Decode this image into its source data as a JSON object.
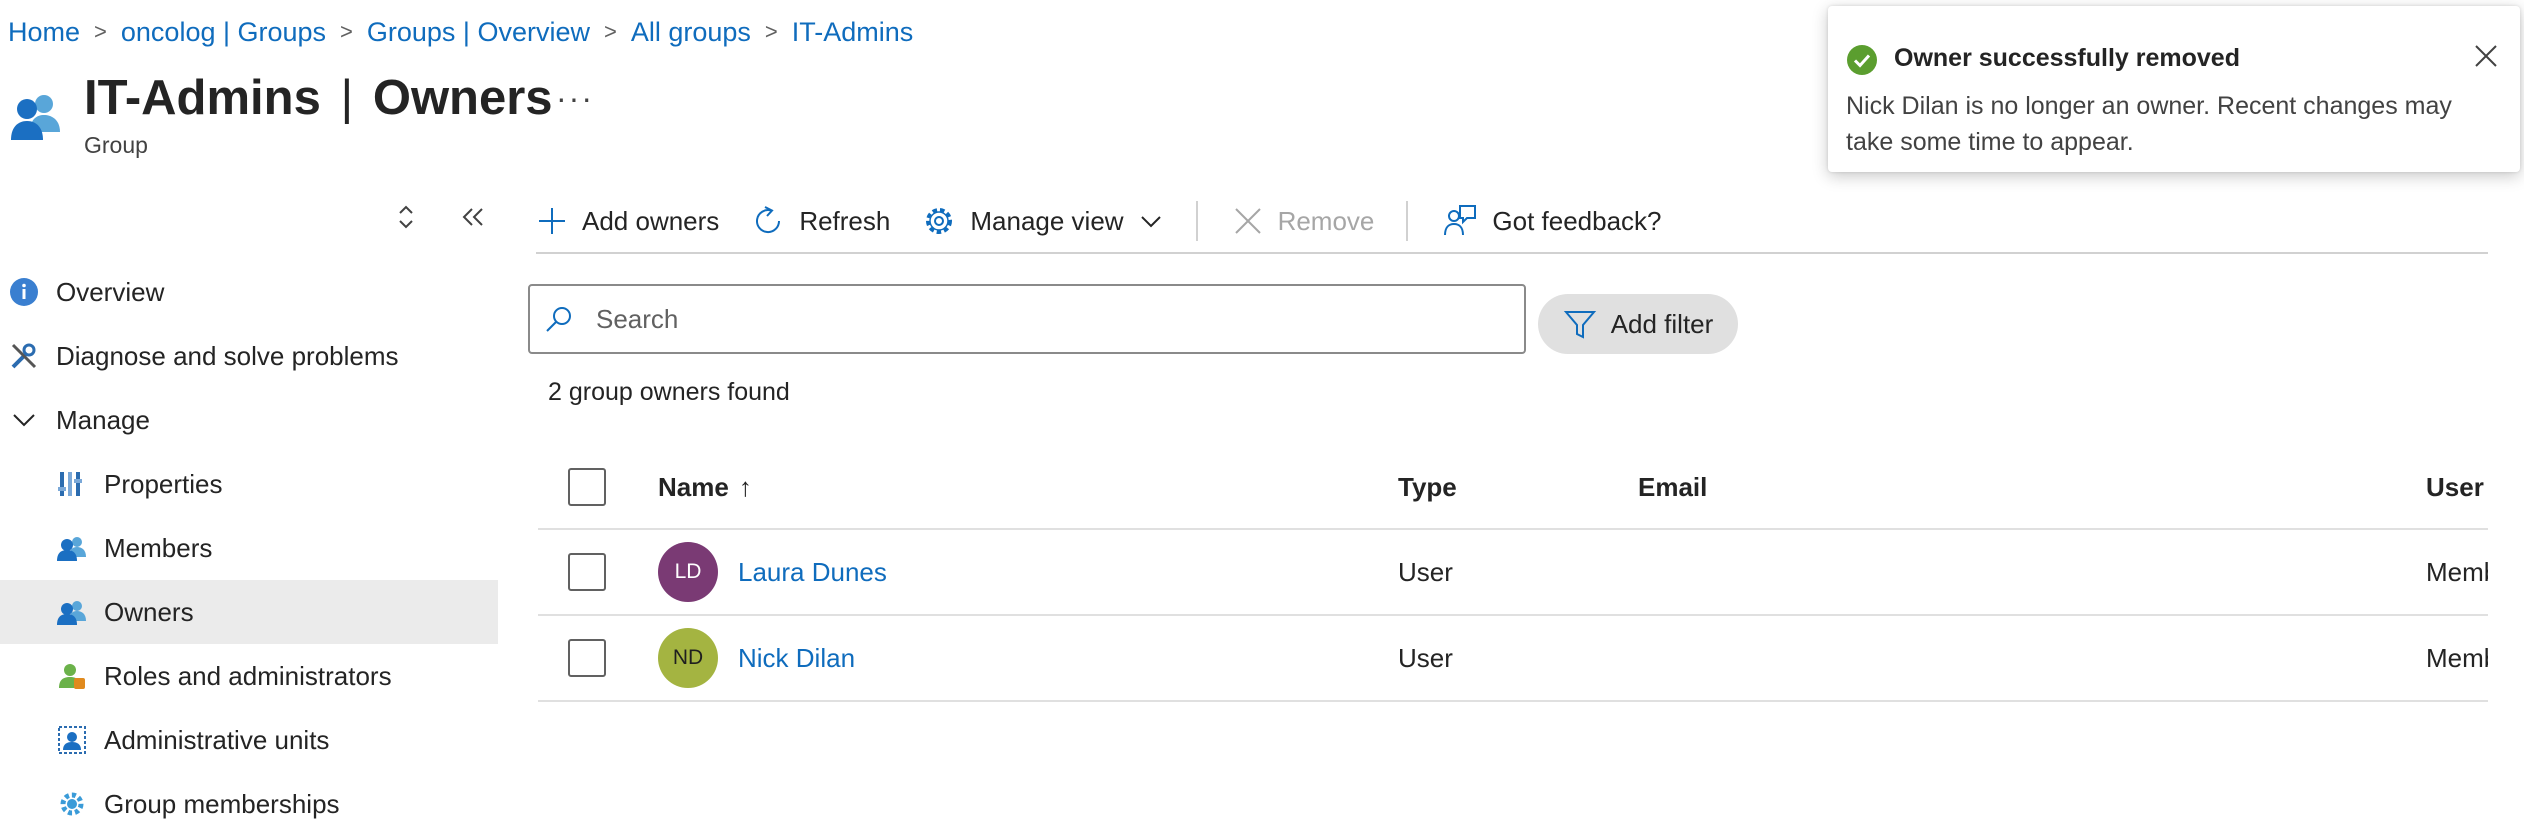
{
  "breadcrumb": [
    "Home",
    "oncolog | Groups",
    "Groups | Overview",
    "All groups",
    "IT-Admins"
  ],
  "header": {
    "title_strong": "IT-Admins",
    "title_divider": "|",
    "title_rest": "Owners",
    "subtitle": "Group",
    "more_label": "···",
    "icon": "group-icon"
  },
  "sidebar": {
    "sort_icon": "up-down-icon",
    "collapse_icon": "double-chevron-left-icon",
    "items": [
      {
        "label": "Overview",
        "icon": "info-icon"
      },
      {
        "label": "Diagnose and solve problems",
        "icon": "wrench-icon"
      },
      {
        "label": "Manage",
        "icon": "chevron-down-icon"
      },
      {
        "label": "Properties",
        "icon": "properties-icon"
      },
      {
        "label": "Members",
        "icon": "people-icon"
      },
      {
        "label": "Owners",
        "icon": "people-icon",
        "selected": true
      },
      {
        "label": "Roles and administrators",
        "icon": "person-badge-icon"
      },
      {
        "label": "Administrative units",
        "icon": "admin-units-icon"
      },
      {
        "label": "Group memberships",
        "icon": "gear-icon"
      }
    ]
  },
  "toolbar": {
    "add_owners": "Add owners",
    "refresh": "Refresh",
    "manage_view": "Manage view",
    "remove": "Remove",
    "feedback": "Got feedback?"
  },
  "search": {
    "placeholder": "Search",
    "value": ""
  },
  "filter": {
    "label": "Add filter"
  },
  "results": {
    "count_text": "2 group owners found"
  },
  "table": {
    "columns": {
      "name": "Name",
      "sort_indicator": "↑",
      "type": "Type",
      "email": "Email",
      "user_type": "User type"
    },
    "rows": [
      {
        "initials": "LD",
        "name": "Laura Dunes",
        "type": "User",
        "email": "",
        "user_type": "Member",
        "avatar_color": "#7a3a74"
      },
      {
        "initials": "ND",
        "name": "Nick Dilan",
        "type": "User",
        "email": "",
        "user_type": "Member",
        "avatar_color": "#a4b441"
      }
    ]
  },
  "toast": {
    "title": "Owner successfully removed",
    "body": "Nick Dilan is no longer an owner. Recent changes may take some time to appear.",
    "status_color": "#5b9e2f"
  },
  "colors": {
    "accent": "#0f6cbd",
    "selected_bg": "#ebebeb",
    "success": "#5b9e2f"
  }
}
